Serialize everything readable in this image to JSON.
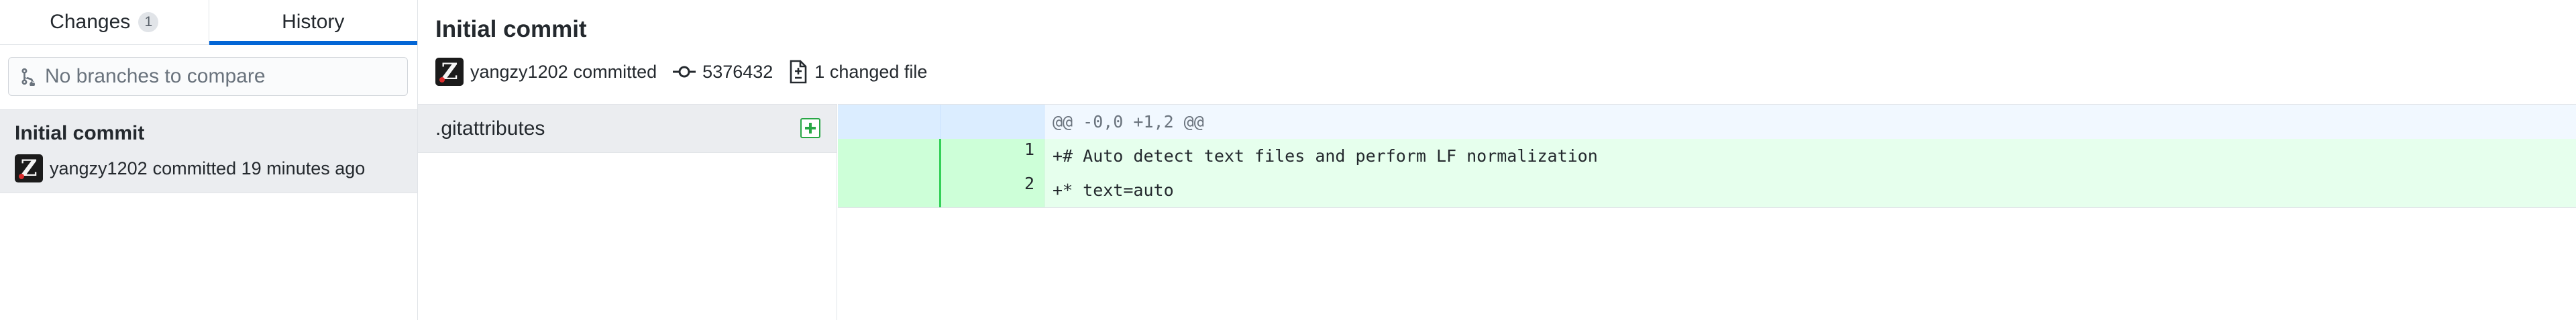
{
  "sidebar": {
    "tabs": [
      {
        "label": "Changes",
        "count": "1"
      },
      {
        "label": "History"
      }
    ],
    "compare_placeholder": "No branches to compare",
    "commit": {
      "title": "Initial commit",
      "author": "yangzy1202",
      "meta": "committed 19 minutes ago"
    }
  },
  "header": {
    "title": "Initial commit",
    "author": "yangzy1202",
    "committed_label": "committed",
    "sha": "5376432",
    "changed_files": "1 changed file"
  },
  "files": [
    {
      "name": ".gitattributes",
      "status": "added"
    }
  ],
  "diff": {
    "hunk": "@@ -0,0 +1,2 @@",
    "lines": [
      {
        "old": "",
        "new": "1",
        "text": "+# Auto detect text files and perform LF normalization"
      },
      {
        "old": "",
        "new": "2",
        "text": "+* text=auto"
      }
    ]
  },
  "colors": {
    "accent": "#0366d6",
    "added_bg": "#e6ffed",
    "added_gutter": "#cdffd8",
    "hunk_bg": "#f1f8ff",
    "added_icon": "#28a745"
  },
  "icons": {
    "compare": "git-compare-icon",
    "commit": "git-commit-icon",
    "diff": "file-diff-icon",
    "file_status": "file-added-icon"
  }
}
